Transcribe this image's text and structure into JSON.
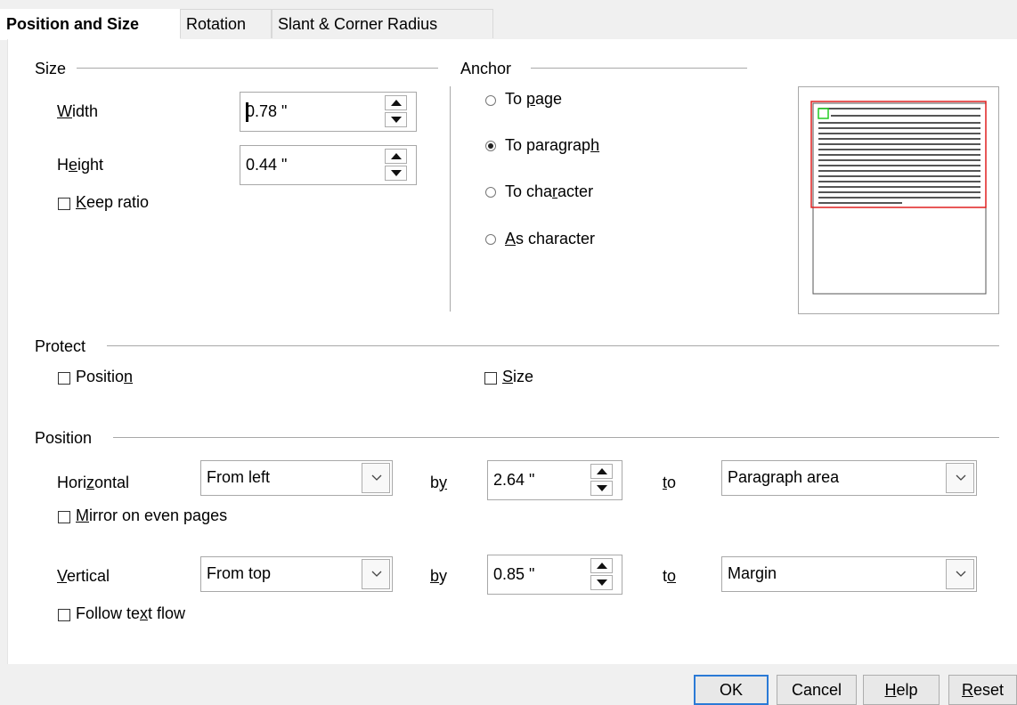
{
  "tabs": [
    "Position and Size",
    "Rotation",
    "Slant & Corner Radius"
  ],
  "size": {
    "title": "Size",
    "width_label": "Width",
    "width_value": "0.78 \"",
    "height_label": "Height",
    "height_value": "0.44 \"",
    "keep_ratio": "Keep ratio"
  },
  "anchor": {
    "title": "Anchor",
    "options": [
      "To page",
      "To paragraph",
      "To character",
      "As character"
    ],
    "selected": "To paragraph"
  },
  "protect": {
    "title": "Protect",
    "position": "Position",
    "size": "Size"
  },
  "position": {
    "title": "Position",
    "horizontal_label": "Horizontal",
    "horizontal_value": "From left",
    "h_by_label": "by",
    "h_by_value": "2.64 \"",
    "h_to_label": "to",
    "h_to_value": "Paragraph area",
    "mirror": "Mirror on even pages",
    "vertical_label": "Vertical",
    "vertical_value": "From top",
    "v_by_label": "by",
    "v_by_value": "0.85 \"",
    "v_to_label": "to",
    "v_to_value": "Margin",
    "follow": "Follow text flow"
  },
  "buttons": {
    "ok": "OK",
    "cancel": "Cancel",
    "help": "Help",
    "reset": "Reset"
  },
  "colors": {
    "accent": "#2b7ad6",
    "preview_frame": "#e02020",
    "preview_object": "#22cc22"
  }
}
